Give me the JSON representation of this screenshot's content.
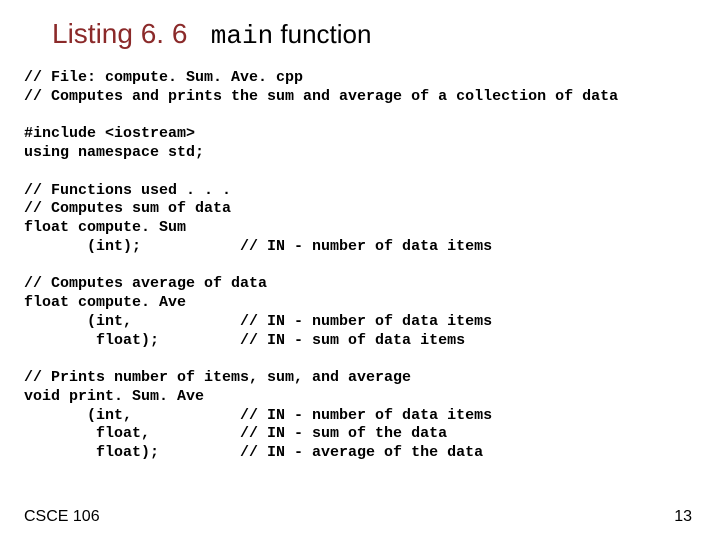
{
  "heading": {
    "listing": "Listing 6. 6",
    "main_kw": "main",
    "fn_word": " function"
  },
  "code": {
    "l01": "// File: compute. Sum. Ave. cpp",
    "l02": "// Computes and prints the sum and average of a collection of data",
    "l03": "",
    "l04": "#include <iostream>",
    "l05": "using namespace std;",
    "l06": "",
    "l07": "// Functions used . . .",
    "l08": "// Computes sum of data",
    "l09": "float compute. Sum",
    "l10": "       (int);           // IN - number of data items",
    "l11": "",
    "l12": "// Computes average of data",
    "l13": "float compute. Ave",
    "l14": "       (int,            // IN - number of data items",
    "l15": "        float);         // IN - sum of data items",
    "l16": "",
    "l17": "// Prints number of items, sum, and average",
    "l18": "void print. Sum. Ave",
    "l19": "       (int,            // IN - number of data items",
    "l20": "        float,          // IN - sum of the data",
    "l21": "        float);         // IN - average of the data"
  },
  "footer": {
    "left": "CSCE 106",
    "right": "13"
  }
}
